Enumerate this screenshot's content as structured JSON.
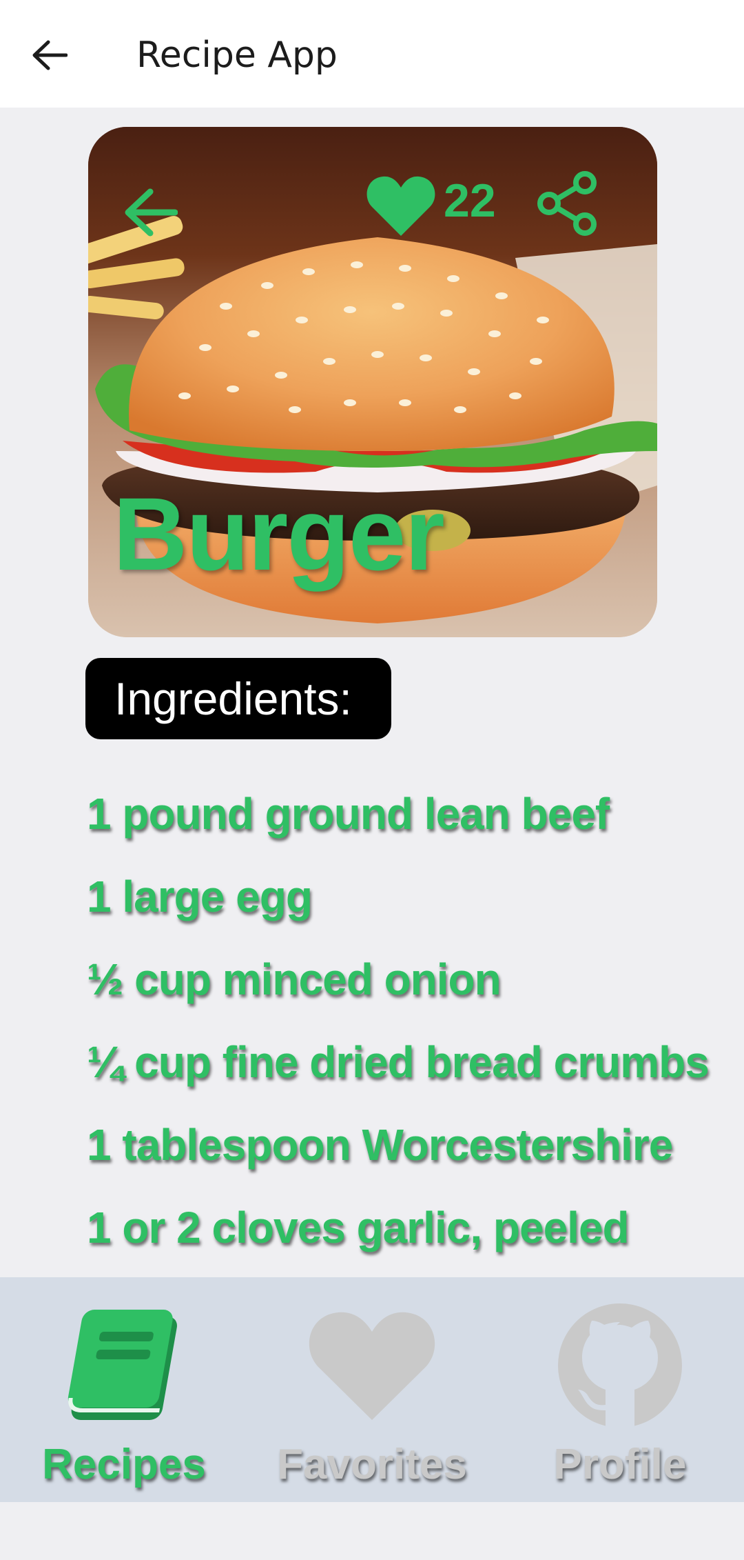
{
  "app_bar": {
    "title": "Recipe App",
    "back_icon": "arrow-left-icon"
  },
  "recipe": {
    "name": "Burger",
    "likes": "22",
    "back_icon": "arrow-left-icon",
    "favorite_icon": "heart-icon",
    "share_icon": "share-icon",
    "accent_color": "#2fbf64"
  },
  "ingredients": {
    "heading": "Ingredients:",
    "items": [
      "1 pound ground lean beef",
      "1 large egg",
      "½ cup minced onion",
      "¼ cup fine dried bread crumbs",
      "1 tablespoon Worcestershire",
      "1 or 2 cloves garlic, peeled"
    ]
  },
  "bottom_nav": {
    "items": [
      {
        "label": "Recipes",
        "icon": "book-icon",
        "active": true,
        "color": "#2fbf64"
      },
      {
        "label": "Favorites",
        "icon": "heart-icon",
        "active": false,
        "color": "#c9c9c9"
      },
      {
        "label": "Profile",
        "icon": "github-icon",
        "active": false,
        "color": "#c9c9c9"
      }
    ],
    "background": "#d5dce6"
  }
}
